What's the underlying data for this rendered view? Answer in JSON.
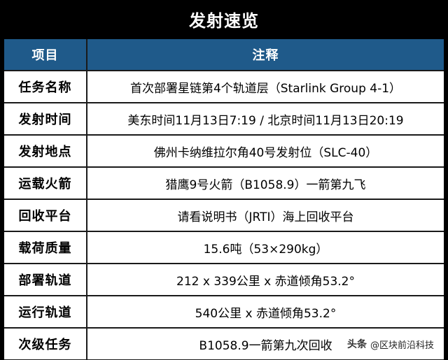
{
  "title": "发射速览",
  "header": {
    "col1": "项目",
    "col2": "注释"
  },
  "rows": [
    {
      "label": "任务名称",
      "value": "首次部署星链第4个轨道层（Starlink Group 4-1）"
    },
    {
      "label": "发射时间",
      "value": "美东时间11月13日7:19 / 北京时间11月13日20:19"
    },
    {
      "label": "发射地点",
      "value": "佛州卡纳维拉尔角40号发射位（SLC-40）"
    },
    {
      "label": "运载火箭",
      "value": "猎鹰9号火箭（B1058.9）一箭第九飞"
    },
    {
      "label": "回收平台",
      "value": "请看说明书（JRTI）海上回收平台"
    },
    {
      "label": "载荷质量",
      "value": "15.6吨（53×290kg）"
    },
    {
      "label": "部署轨道",
      "value": "212 x 339公里 x 赤道倾角53.2°"
    },
    {
      "label": "运行轨道",
      "value": "540公里 x 赤道倾角53.2°"
    },
    {
      "label": "次级任务",
      "value": "B1058.9一箭第九次回收"
    }
  ],
  "watermark": {
    "logo": "头条",
    "text": "@区块前沿科技"
  },
  "colors": {
    "background": "#000000",
    "header_bg": "#1f5a8a",
    "cell_bg": "#ffffff",
    "grid": "#1a1a1a"
  }
}
